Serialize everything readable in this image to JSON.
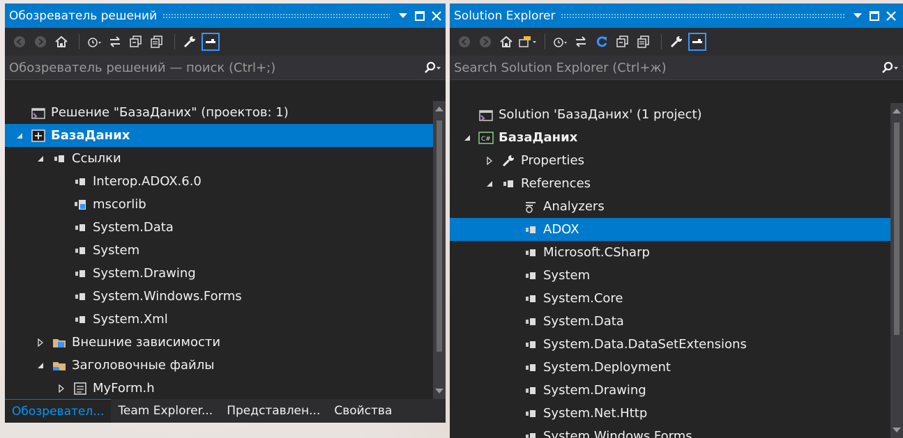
{
  "left_panel": {
    "title": "Обозреватель решений",
    "search_placeholder": "Обозреватель решений — поиск (Ctrl+;)",
    "tree": [
      {
        "label": "Решение \"БазаДаних\"  (проектов: 1)",
        "indent": 0,
        "icon": "solution-icon",
        "expander": ""
      },
      {
        "label": "БазаДаних",
        "indent": 0,
        "icon": "cpp-project-icon",
        "expander": "expanded",
        "selected": true,
        "bold": true
      },
      {
        "label": "Ссылки",
        "indent": 1,
        "icon": "references-icon",
        "expander": "expanded"
      },
      {
        "label": "Interop.ADOX.6.0",
        "indent": 2,
        "icon": "reference-icon"
      },
      {
        "label": "mscorlib",
        "indent": 2,
        "icon": "reference-blue-icon"
      },
      {
        "label": "System.Data",
        "indent": 2,
        "icon": "reference-icon"
      },
      {
        "label": "System",
        "indent": 2,
        "icon": "reference-icon"
      },
      {
        "label": "System.Drawing",
        "indent": 2,
        "icon": "reference-icon"
      },
      {
        "label": "System.Windows.Forms",
        "indent": 2,
        "icon": "reference-icon"
      },
      {
        "label": "System.Xml",
        "indent": 2,
        "icon": "reference-icon"
      },
      {
        "label": "Внешние зависимости",
        "indent": 1,
        "icon": "external-deps-icon",
        "expander": "collapsed"
      },
      {
        "label": "Заголовочные файлы",
        "indent": 1,
        "icon": "header-folder-icon",
        "expander": "expanded"
      },
      {
        "label": "MyForm.h",
        "indent": 2,
        "icon": "form-file-icon",
        "expander": "collapsed"
      }
    ],
    "tabs": [
      "Обозревател...",
      "Team Explorer...",
      "Представлен...",
      "Свойства"
    ]
  },
  "right_panel": {
    "title": "Solution Explorer",
    "search_placeholder": "Search Solution Explorer (Ctrl+ж)",
    "tree": [
      {
        "label": "Solution 'БазаДаних' (1 project)",
        "indent": 0,
        "icon": "solution-icon",
        "expander": ""
      },
      {
        "label": "БазаДаних",
        "indent": 0,
        "icon": "csharp-project-icon",
        "expander": "expanded",
        "bold": true
      },
      {
        "label": "Properties",
        "indent": 1,
        "icon": "wrench-icon",
        "expander": "collapsed"
      },
      {
        "label": "References",
        "indent": 1,
        "icon": "references-icon",
        "expander": "expanded"
      },
      {
        "label": "Analyzers",
        "indent": 2,
        "icon": "analyzers-icon"
      },
      {
        "label": "ADOX",
        "indent": 2,
        "icon": "reference-icon",
        "selected": true
      },
      {
        "label": "Microsoft.CSharp",
        "indent": 2,
        "icon": "reference-icon"
      },
      {
        "label": "System",
        "indent": 2,
        "icon": "reference-icon"
      },
      {
        "label": "System.Core",
        "indent": 2,
        "icon": "reference-icon"
      },
      {
        "label": "System.Data",
        "indent": 2,
        "icon": "reference-icon"
      },
      {
        "label": "System.Data.DataSetExtensions",
        "indent": 2,
        "icon": "reference-icon"
      },
      {
        "label": "System.Deployment",
        "indent": 2,
        "icon": "reference-icon"
      },
      {
        "label": "System.Drawing",
        "indent": 2,
        "icon": "reference-icon"
      },
      {
        "label": "System.Net.Http",
        "indent": 2,
        "icon": "reference-icon"
      },
      {
        "label": "System.Windows.Forms",
        "indent": 2,
        "icon": "reference-icon"
      }
    ]
  },
  "colors": {
    "accent": "#007acc",
    "panel_bg": "#252526",
    "selected_bg": "#007acc"
  }
}
